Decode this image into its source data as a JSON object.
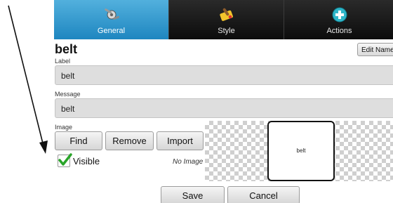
{
  "tabs": [
    {
      "label": "General",
      "icon": "wrench-gear-icon",
      "selected": true
    },
    {
      "label": "Style",
      "icon": "paintbrush-icon",
      "selected": false
    },
    {
      "label": "Actions",
      "icon": "plus-circle-icon",
      "selected": false
    }
  ],
  "object": {
    "title": "belt",
    "edit_name_label": "Edit Name"
  },
  "label_field": {
    "caption": "Label",
    "value": "belt"
  },
  "message_field": {
    "caption": "Message",
    "value": "belt"
  },
  "image": {
    "caption": "Image",
    "find_label": "Find",
    "remove_label": "Remove",
    "import_label": "Import",
    "no_image_text": "No Image"
  },
  "visible": {
    "label": "Visible",
    "checked": true
  },
  "preview": {
    "text": "belt"
  },
  "footer": {
    "save_label": "Save",
    "cancel_label": "Cancel"
  },
  "colors": {
    "selected_tab": "#2e97d0",
    "tab_bar": "#1a1a1a",
    "check": "#2aa52a"
  }
}
